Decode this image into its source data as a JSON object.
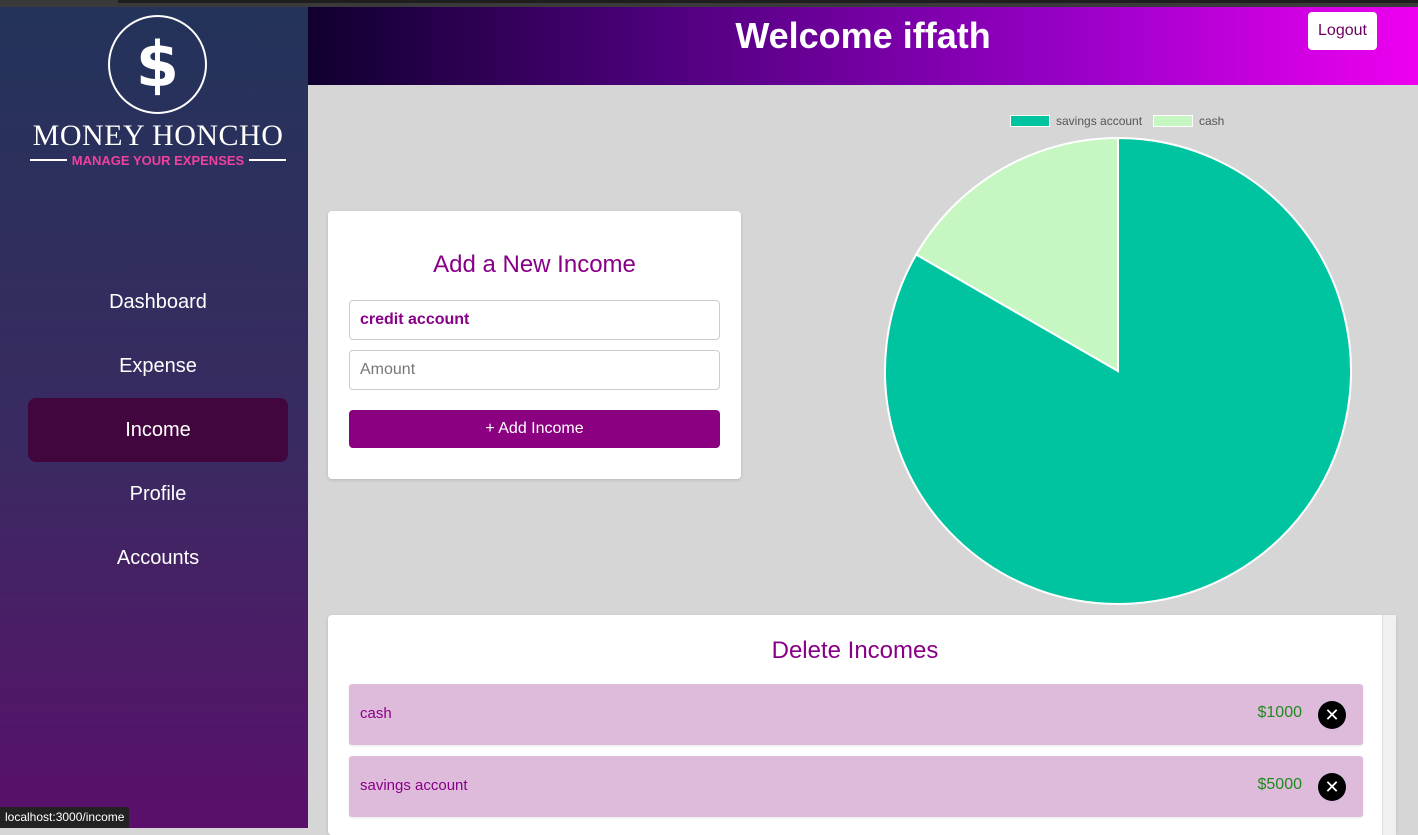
{
  "sidebar": {
    "logo_symbol": "$",
    "logo_title": "MONEY HONCHO",
    "logo_subtitle": "MANAGE YOUR EXPENSES",
    "items": [
      {
        "label": "Dashboard",
        "active": false
      },
      {
        "label": "Expense",
        "active": false
      },
      {
        "label": "Income",
        "active": true
      },
      {
        "label": "Profile",
        "active": false
      },
      {
        "label": "Accounts",
        "active": false
      }
    ]
  },
  "header": {
    "title": "Welcome iffath",
    "logout_label": "Logout"
  },
  "income_form": {
    "title": "Add a New Income",
    "account_value": "credit account",
    "amount_placeholder": "Amount",
    "add_label": "+ Add Income"
  },
  "chart_data": {
    "type": "pie",
    "categories": [
      "savings account",
      "cash"
    ],
    "values": [
      5000,
      1000
    ],
    "colors": [
      "#00c4a0",
      "#c6f6c1"
    ],
    "legend": "top"
  },
  "delete_incomes": {
    "title": "Delete Incomes",
    "rows": [
      {
        "name": "cash",
        "amount": "$1000"
      },
      {
        "name": "savings account",
        "amount": "$5000"
      }
    ]
  },
  "status_url": "localhost:3000/income",
  "colors": {
    "accent": "#880088",
    "button": "#8a0080",
    "amount_green": "#1e8a1e",
    "row_bg": "#dfbbdb"
  }
}
